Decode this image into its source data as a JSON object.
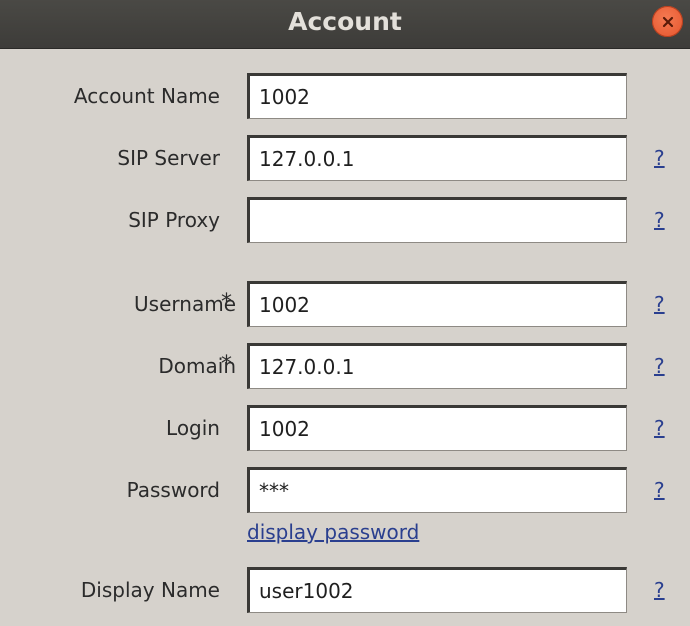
{
  "window": {
    "title": "Account",
    "close_icon": "close-icon"
  },
  "fields": {
    "account_name": {
      "label": "Account Name",
      "value": "1002"
    },
    "sip_server": {
      "label": "SIP Server",
      "value": "127.0.0.1",
      "help": "?"
    },
    "sip_proxy": {
      "label": "SIP Proxy",
      "value": "",
      "help": "?"
    },
    "username": {
      "label": "Username",
      "required_mark": "*",
      "value": "1002",
      "help": "?"
    },
    "domain": {
      "label": "Domain",
      "required_mark": "*",
      "value": "127.0.0.1",
      "help": "?"
    },
    "login": {
      "label": "Login",
      "value": "1002",
      "help": "?"
    },
    "password": {
      "label": "Password",
      "value": "***",
      "help": "?"
    },
    "display_password_link": "display password",
    "display_name": {
      "label": "Display Name",
      "value": "user1002",
      "help": "?"
    }
  },
  "colors": {
    "titlebar": "#3d3c39",
    "background": "#d6d2cc",
    "close_button": "#e5532b",
    "link": "#2a3f8f"
  }
}
